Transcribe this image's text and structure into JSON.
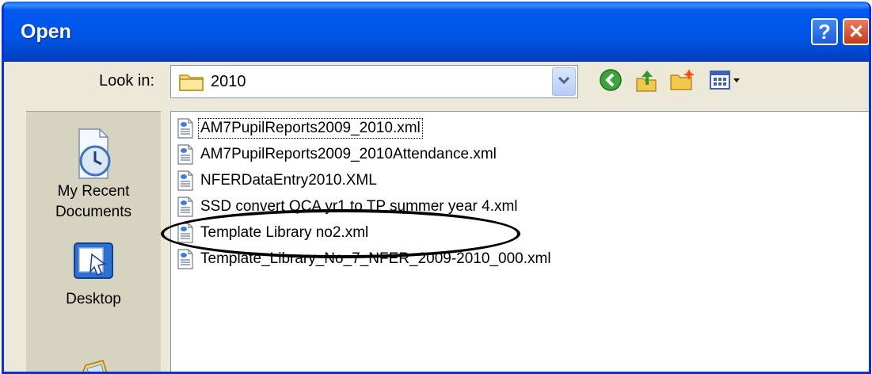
{
  "window": {
    "title": "Open"
  },
  "titlebar": {
    "help_label": "?",
    "close_label": "✕"
  },
  "lookin": {
    "label": "Look in:",
    "value": "2010"
  },
  "toolbar": {
    "icons": [
      "back-icon",
      "up-folder-icon",
      "new-folder-icon",
      "views-menu-icon"
    ]
  },
  "places": [
    {
      "label_line1": "My Recent",
      "label_line2": "Documents",
      "icon": "recent-documents-icon"
    },
    {
      "label_line1": "Desktop",
      "label_line2": "",
      "icon": "desktop-icon"
    },
    {
      "label_line1": "",
      "label_line2": "",
      "icon": "my-documents-icon"
    }
  ],
  "files": [
    {
      "name": "AM7PupilReports2009_2010.xml"
    },
    {
      "name": "AM7PupilReports2009_2010Attendance.xml"
    },
    {
      "name": "NFERDataEntry2010.XML"
    },
    {
      "name": "SSD convert QCA yr1 to TP summer year 4.xml"
    },
    {
      "name": "Template Library no2.xml"
    },
    {
      "name": "Template_Library_No_7_NFER_2009-2010_000.xml"
    }
  ],
  "colors": {
    "titlebar": "#0055e5",
    "window_bg": "#ece9d8",
    "annotation": "#000000"
  }
}
